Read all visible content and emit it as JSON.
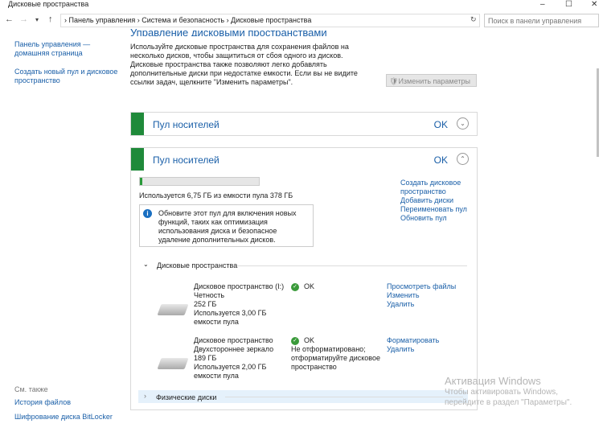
{
  "window": {
    "title": "Дисковые пространства",
    "minimize": "–",
    "maximize": "☐",
    "close": "✕"
  },
  "address": {
    "back": "←",
    "forward": "→",
    "dropdown": "▾",
    "up": "↑",
    "crumbs": [
      "Панель управления",
      "Система и безопасность",
      "Дисковые пространства"
    ],
    "sep": "›",
    "refresh": "↻",
    "search_placeholder": "Поиск в панели управления"
  },
  "sidebar": {
    "items": [
      "Панель управления — домашняя страница",
      "Создать новый пул и дисковое пространство"
    ],
    "see_also": "См. также",
    "see_also_items": [
      "История файлов",
      "Шифрование диска BitLocker"
    ]
  },
  "main": {
    "title": "Управление дисковыми пространствами",
    "intro": "Используйте дисковые пространства для сохранения файлов на несколько дисков, чтобы защититься от сбоя одного из дисков. Дисковые пространства также позволяют легко добавлять дополнительные диски при недостатке емкости. Если вы не видите ссылки задач, щелкните \"Изменить параметры\".",
    "change_settings": "Изменить параметры",
    "pools": [
      {
        "title": "Пул носителей",
        "status": "OK",
        "chevron": "⌄"
      },
      {
        "title": "Пул носителей",
        "status": "OK",
        "chevron": "⌃",
        "usage_fraction": 0.018,
        "usage_text": "Используется 6,75 ГБ из емкости пула 378 ГБ",
        "info": "Обновите этот пул для включения новых функций, таких как оптимизация использования диска и безопасное удаление дополнительных дисков.",
        "actions": [
          "Создать дисковое пространство",
          "Добавить диски",
          "Переименовать пул",
          "Обновить пул"
        ],
        "spaces_header": "Дисковые пространства",
        "spaces": [
          {
            "name": "Дисковое пространство (I:)",
            "layout": "Четность",
            "size": "252 ГБ",
            "used": "Используется 3,00 ГБ емкости пула",
            "status": "OK",
            "status_note": "",
            "actions": [
              "Просмотреть файлы",
              "Изменить",
              "Удалить"
            ]
          },
          {
            "name": "Дисковое пространство",
            "layout": "Двухстороннее зеркало",
            "size": "189 ГБ",
            "used": "Используется 2,00 ГБ емкости пула",
            "status": "OK",
            "status_note": "Не отформатировано; отформатируйте дисковое пространство",
            "actions": [
              "Форматировать",
              "Удалить"
            ]
          }
        ],
        "physical_header": "Физические диски"
      }
    ]
  },
  "watermark": {
    "title": "Активация Windows",
    "line1": "Чтобы активировать Windows,",
    "line2": "перейдите в раздел \"Параметры\"."
  }
}
